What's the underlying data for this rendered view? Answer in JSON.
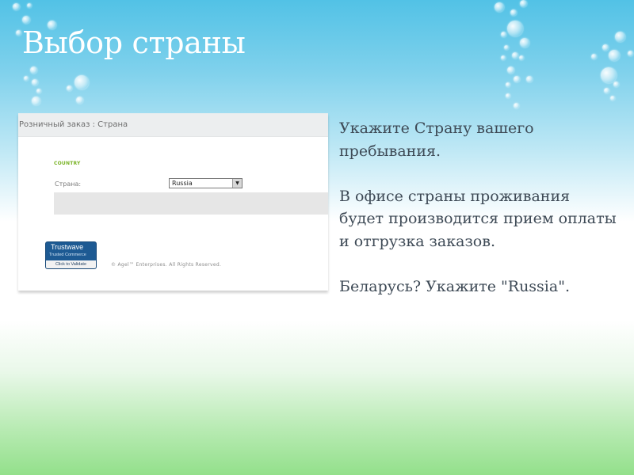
{
  "slide": {
    "title": "Выбор страны"
  },
  "screenshot": {
    "breadcrumb": "Розничный заказ : Страна",
    "section_label": "COUNTRY",
    "field_label": "Страна:",
    "select_value": "Russia",
    "trustwave": {
      "brand": "Trustwave",
      "tagline": "Trusted Commerce",
      "action": "Click to Validate"
    },
    "copyright": "© Agel™ Enterprises. All Rights Reserved."
  },
  "instructions": {
    "paragraph_1": "Укажите Страну вашего пребывания.",
    "paragraph_2": "В офисе страны проживания будет производится прием оплаты и отгрузка заказов.",
    "paragraph_3": "Беларусь? Укажите \"Russia\"."
  },
  "colors": {
    "sky_top": "#52c2e6",
    "grass_bottom": "#93e08b",
    "country_label": "#7ab327",
    "text": "#3e4a56"
  },
  "icons": {
    "select_arrow": "chevron-down-icon",
    "trust_seal": "trustwave-seal-icon"
  }
}
